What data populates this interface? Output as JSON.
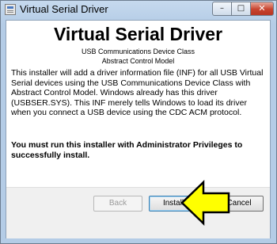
{
  "window": {
    "title": "Virtual Serial Driver",
    "controls": {
      "minimize": "–",
      "maximize": "□",
      "close": "✕"
    }
  },
  "content": {
    "heading": "Virtual Serial Driver",
    "subtitle_line1": "USB Communications Device Class",
    "subtitle_line2": "Abstract Control Model",
    "body": "This installer will add a driver information file (INF) for all USB Virtual Serial devices using the USB Communications Device Class with Abstract Control Model.  Windows already has this driver (USBSER.SYS).  This INF merely tells Windows to load its driver when you connect a USB device using the CDC ACM protocol.",
    "warning": "You must run this installer with Administrator Privileges to successfully install."
  },
  "buttons": {
    "back": "Back",
    "install": "Install",
    "cancel": "Cancel"
  },
  "overlay": {
    "arrow_icon": "yellow-arrow-pointing-left",
    "arrow_color": "#ffff00"
  }
}
